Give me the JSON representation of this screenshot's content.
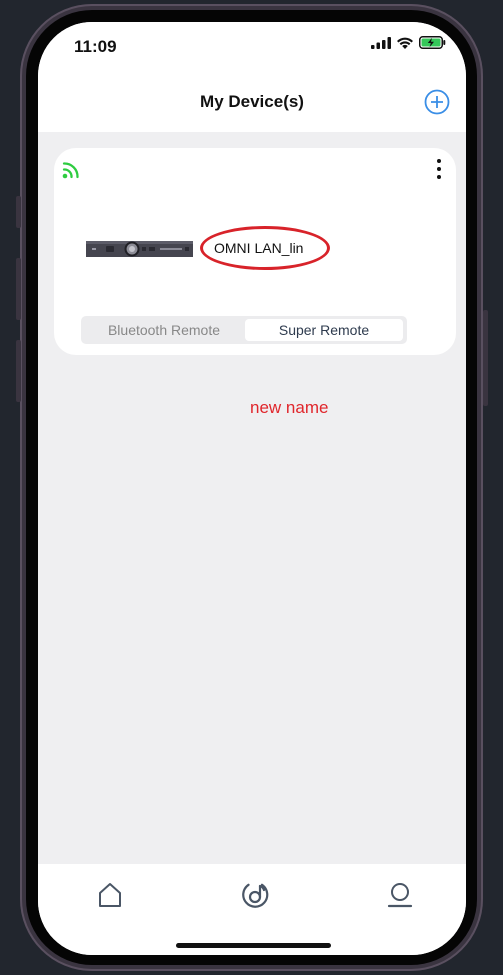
{
  "status_bar": {
    "time": "11:09"
  },
  "header": {
    "title": "My Device(s)"
  },
  "device_card": {
    "device_name": "OMNI LAN_lin",
    "remote_modes": {
      "options": [
        "Bluetooth Remote",
        "Super Remote"
      ],
      "selected": "Super Remote"
    }
  },
  "annotation": {
    "text": "new name"
  },
  "colors": {
    "accent_blue": "#3a8ee6",
    "wifi_green": "#2ecc40",
    "annotation_red": "#e0262c",
    "battery_green": "#34c759",
    "tab_icon": "#4a5666"
  },
  "icons": {
    "add": "plus-circle-icon",
    "connection": "wifi-signal-icon",
    "more": "more-vertical-icon",
    "tabs": [
      "home-icon",
      "music-disc-icon",
      "user-icon"
    ]
  }
}
